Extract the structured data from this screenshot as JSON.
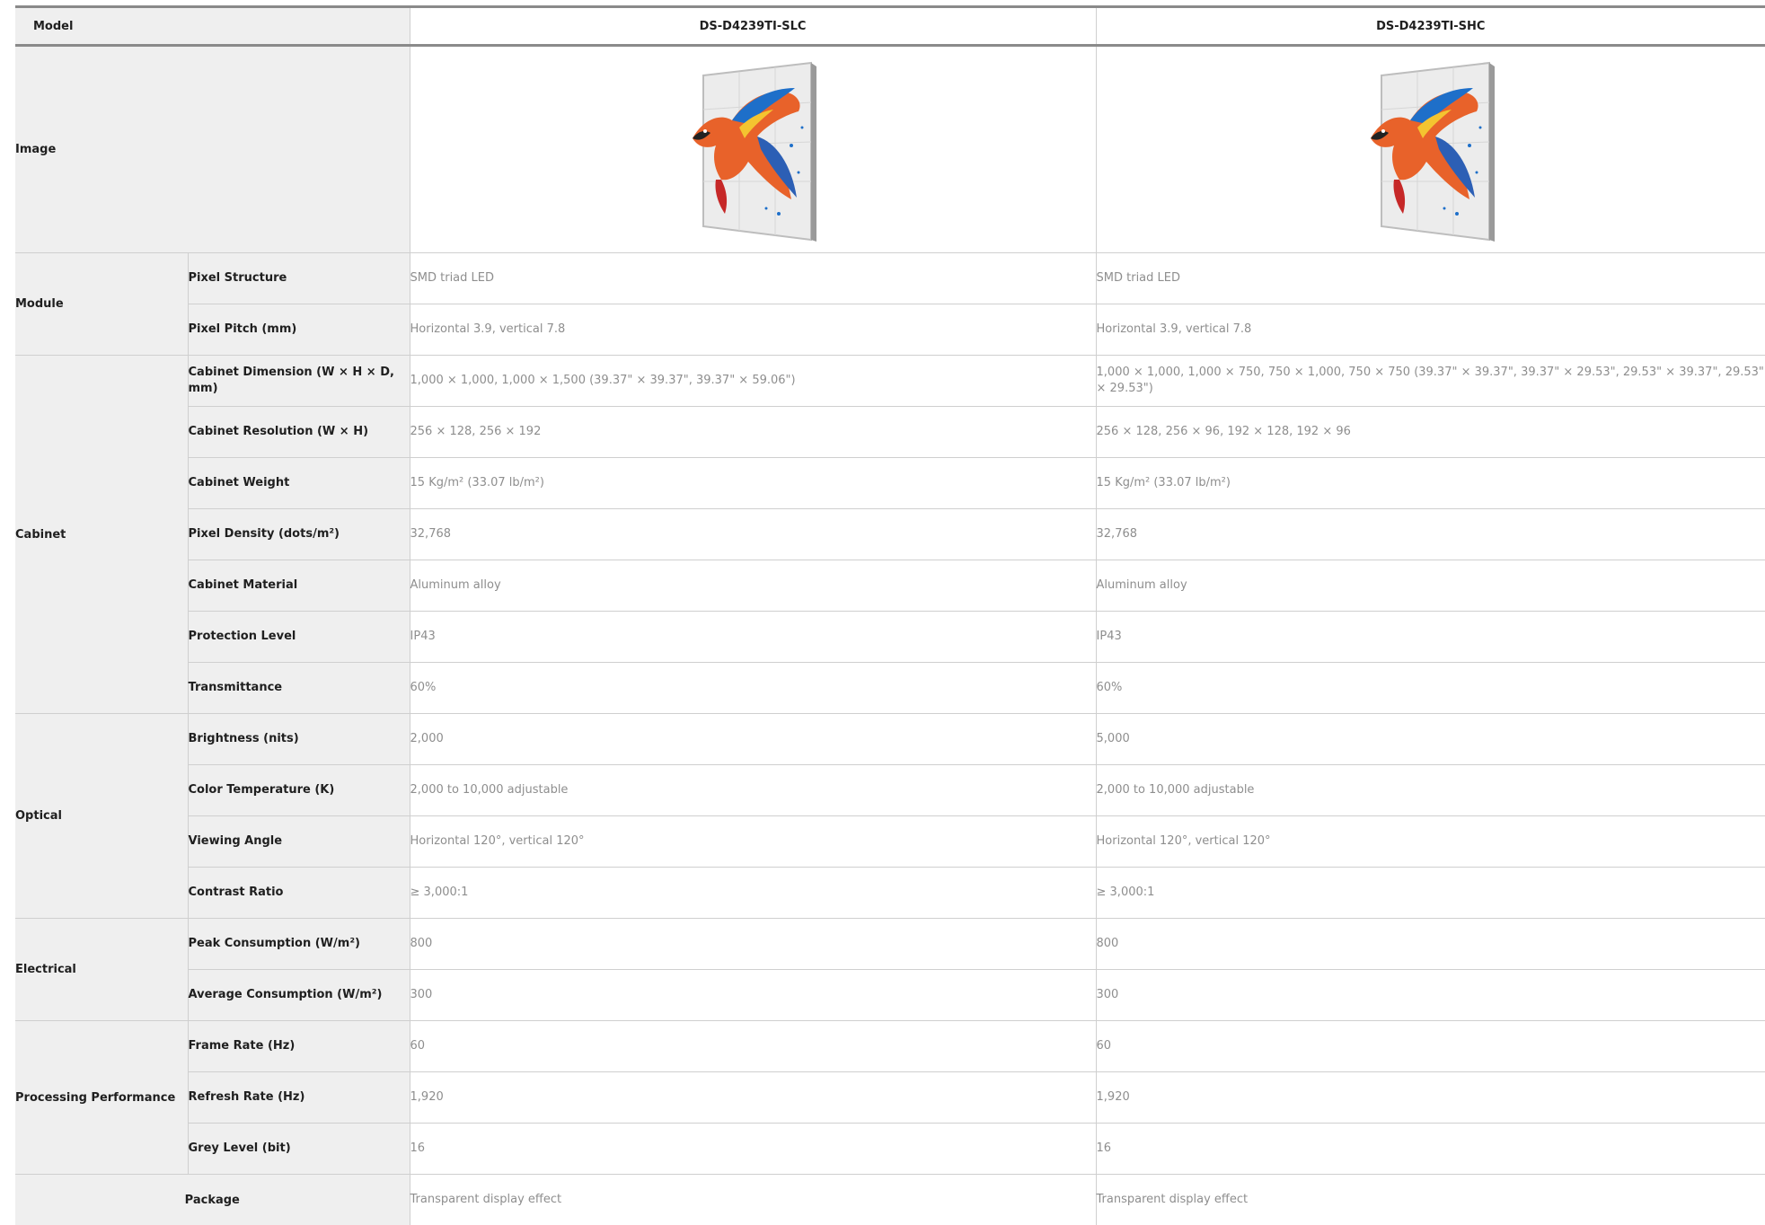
{
  "header": {
    "model_label": "Model",
    "models": [
      "DS-D4239TI-SLC",
      "DS-D4239TI-SHC"
    ]
  },
  "image_row": {
    "label": "Image",
    "image_desc": "parrot-display-image"
  },
  "groups": [
    {
      "name": "Module",
      "rows": [
        {
          "label": "Pixel Structure",
          "values": [
            "SMD triad LED",
            "SMD triad LED"
          ]
        },
        {
          "label": "Pixel Pitch (mm)",
          "values": [
            "Horizontal 3.9, vertical 7.8",
            "Horizontal 3.9, vertical 7.8"
          ]
        }
      ]
    },
    {
      "name": "Cabinet",
      "rows": [
        {
          "label": "Cabinet Dimension (W × H × D, mm)",
          "values": [
            "1,000 × 1,000, 1,000 × 1,500 (39.37\" × 39.37\", 39.37\" × 59.06\")",
            "1,000 × 1,000, 1,000 × 750, 750 × 1,000, 750 × 750 (39.37\" × 39.37\", 39.37\" × 29.53\", 29.53\" × 39.37\", 29.53\" × 29.53\")"
          ]
        },
        {
          "label": "Cabinet Resolution (W × H)",
          "values": [
            "256 × 128, 256 × 192",
            "256 × 128, 256 × 96, 192 × 128, 192 × 96"
          ]
        },
        {
          "label": "Cabinet Weight",
          "values": [
            "15 Kg/m² (33.07 lb/m²)",
            "15 Kg/m² (33.07 lb/m²)"
          ]
        },
        {
          "label": "Pixel Density (dots/m²)",
          "values": [
            "32,768",
            "32,768"
          ]
        },
        {
          "label": "Cabinet Material",
          "values": [
            "Aluminum alloy",
            "Aluminum alloy"
          ]
        },
        {
          "label": "Protection Level",
          "values": [
            "IP43",
            "IP43"
          ]
        },
        {
          "label": "Transmittance",
          "values": [
            "60%",
            "60%"
          ]
        }
      ]
    },
    {
      "name": "Optical",
      "rows": [
        {
          "label": "Brightness (nits)",
          "values": [
            "2,000",
            "5,000"
          ]
        },
        {
          "label": "Color Temperature (K)",
          "values": [
            "2,000 to 10,000 adjustable",
            "2,000 to 10,000 adjustable"
          ]
        },
        {
          "label": "Viewing Angle",
          "values": [
            "Horizontal 120°, vertical 120°",
            "Horizontal 120°, vertical 120°"
          ]
        },
        {
          "label": "Contrast Ratio",
          "values": [
            "≥ 3,000:1",
            "≥ 3,000:1"
          ]
        }
      ]
    },
    {
      "name": "Electrical",
      "rows": [
        {
          "label": "Peak Consumption (W/m²)",
          "values": [
            "800",
            "800"
          ]
        },
        {
          "label": "Average Consumption (W/m²)",
          "values": [
            "300",
            "300"
          ]
        }
      ]
    },
    {
      "name": "Processing Performance",
      "rows": [
        {
          "label": "Frame Rate (Hz)",
          "values": [
            "60",
            "60"
          ]
        },
        {
          "label": "Refresh Rate (Hz)",
          "values": [
            "1,920",
            "1,920"
          ]
        },
        {
          "label": "Grey Level (bit)",
          "values": [
            "16",
            "16"
          ]
        }
      ]
    }
  ],
  "package": {
    "label": "Package",
    "values": [
      "Transparent display effect",
      "Transparent display effect"
    ]
  }
}
